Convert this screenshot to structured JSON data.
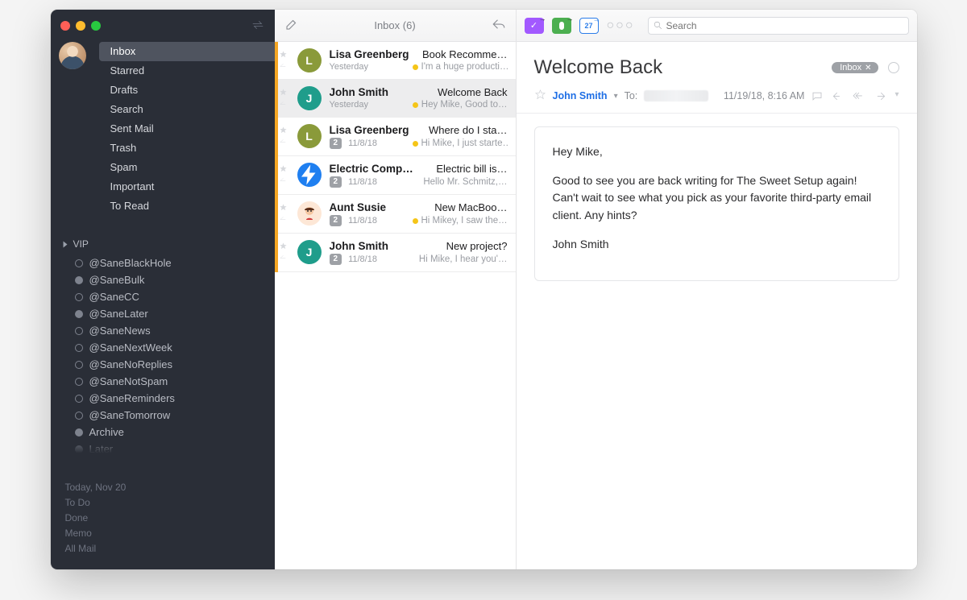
{
  "sidebar": {
    "folders": [
      "Inbox",
      "Starred",
      "Drafts",
      "Search",
      "Sent Mail",
      "Trash",
      "Spam",
      "Important",
      "To Read"
    ],
    "selected": 0,
    "vip_label": "VIP",
    "vip_items": [
      {
        "label": "@SaneBlackHole",
        "filled": false
      },
      {
        "label": "@SaneBulk",
        "filled": true
      },
      {
        "label": "@SaneCC",
        "filled": false
      },
      {
        "label": "@SaneLater",
        "filled": true
      },
      {
        "label": "@SaneNews",
        "filled": false
      },
      {
        "label": "@SaneNextWeek",
        "filled": false
      },
      {
        "label": "@SaneNoReplies",
        "filled": false
      },
      {
        "label": "@SaneNotSpam",
        "filled": false
      },
      {
        "label": "@SaneReminders",
        "filled": false
      },
      {
        "label": "@SaneTomorrow",
        "filled": false
      },
      {
        "label": "Archive",
        "filled": true
      },
      {
        "label": "Later",
        "filled": true
      }
    ],
    "bottom_meta": [
      "Today, Nov 20",
      "To Do",
      "Done",
      "Memo",
      "All Mail"
    ]
  },
  "list": {
    "title": "Inbox (6)",
    "messages": [
      {
        "sender": "Lisa Greenberg",
        "initial": "L",
        "avatar": "av-green",
        "subject": "Book Recomme…",
        "date": "Yesterday",
        "preview": "I'm a huge producti…",
        "yellow": true,
        "count": null,
        "selected": false
      },
      {
        "sender": "John Smith",
        "initial": "J",
        "avatar": "av-teal",
        "subject": "Welcome Back",
        "date": "Yesterday",
        "preview": "Hey Mike, Good to…",
        "yellow": true,
        "count": null,
        "selected": true
      },
      {
        "sender": "Lisa Greenberg",
        "initial": "L",
        "avatar": "av-green",
        "subject": "Where do I sta…",
        "date": "11/8/18",
        "preview": "Hi Mike, I just starte…",
        "yellow": true,
        "count": "2",
        "selected": false
      },
      {
        "sender": "Electric Comp…",
        "initial": "",
        "avatar": "av-bolt",
        "subject": "Electric bill is…",
        "date": "11/8/18",
        "preview": "Hello Mr. Schmitz,…",
        "yellow": false,
        "count": "2",
        "selected": false
      },
      {
        "sender": "Aunt Susie",
        "initial": "",
        "avatar": "av-face",
        "subject": "New MacBoo…",
        "date": "11/8/18",
        "preview": "Hi Mikey, I saw the…",
        "yellow": true,
        "count": "2",
        "selected": false
      },
      {
        "sender": "John Smith",
        "initial": "J",
        "avatar": "av-teal",
        "subject": "New project?",
        "date": "11/8/18",
        "preview": "Hi Mike, I hear you'…",
        "yellow": false,
        "count": "2",
        "selected": false
      }
    ]
  },
  "reader": {
    "search_placeholder": "Search",
    "cal_day": "27",
    "title": "Welcome Back",
    "chip": "Inbox",
    "from": "John Smith",
    "to_label": "To:",
    "timestamp": "11/19/18, 8:16 AM",
    "body_p1": "Hey Mike,",
    "body_p2": "Good to see you are back writing for The Sweet Setup again! Can't wait to see what you pick as your favorite third-party email client. Any hints?",
    "body_sig": "John Smith"
  }
}
